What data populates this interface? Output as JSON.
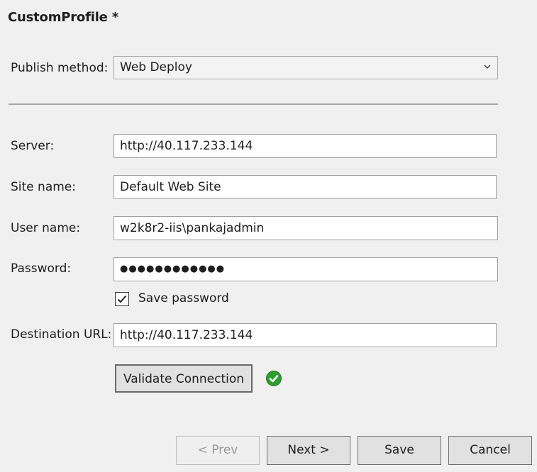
{
  "profile": {
    "title": "CustomProfile *"
  },
  "publish": {
    "label": "Publish method:",
    "value": "Web Deploy",
    "chevron": "ˇ"
  },
  "fields": {
    "server": {
      "label": "Server:",
      "value": "http://40.117.233.144"
    },
    "site_name": {
      "label": "Site name:",
      "value": "Default Web Site"
    },
    "user_name": {
      "label": "User name:",
      "value": "w2k8r2-iis\\pankajadmin"
    },
    "password": {
      "label": "Password:",
      "value": "●●●●●●●●●●●●"
    },
    "destination_url": {
      "label": "Destination URL:",
      "value": "http://40.117.233.144"
    }
  },
  "save_password": {
    "label": "Save password",
    "checked": true
  },
  "validate": {
    "label": "Validate Connection",
    "status_icon": "success-check-icon",
    "status_color": "#2e9e2e"
  },
  "footer": {
    "prev_label": "< Prev",
    "next_label": "Next >",
    "save_label": "Save",
    "cancel_label": "Cancel"
  }
}
